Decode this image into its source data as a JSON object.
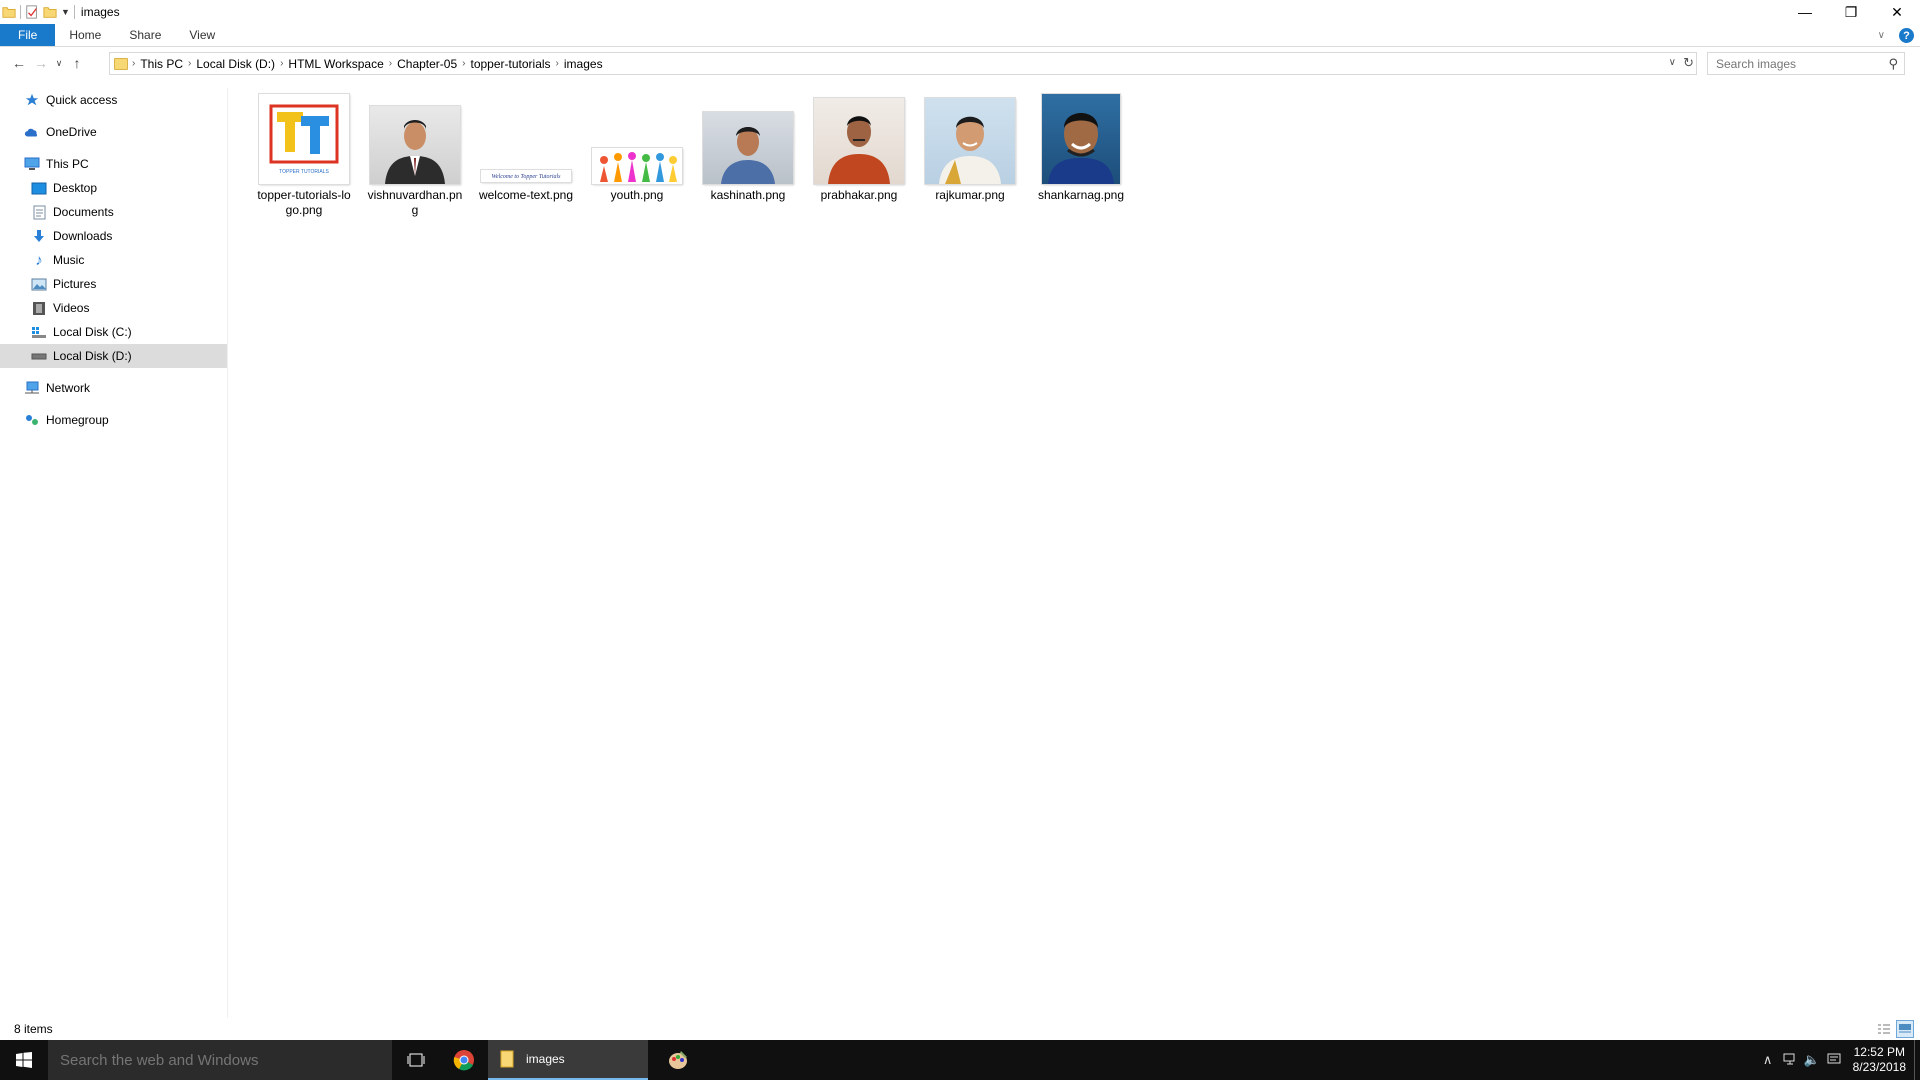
{
  "window": {
    "title": "images",
    "controls": {
      "minimize": "—",
      "restore": "❐",
      "close": "✕"
    }
  },
  "ribbon": {
    "tabs": [
      "File",
      "Home",
      "Share",
      "View"
    ],
    "help": "?"
  },
  "address": {
    "crumbs": [
      "This PC",
      "Local Disk (D:)",
      "HTML Workspace",
      "Chapter-05",
      "topper-tutorials",
      "images"
    ],
    "search_placeholder": "Search images"
  },
  "sidebar": {
    "quick_access": "Quick access",
    "onedrive": "OneDrive",
    "this_pc": "This PC",
    "pc_items": [
      "Desktop",
      "Documents",
      "Downloads",
      "Music",
      "Pictures",
      "Videos",
      "Local Disk (C:)",
      "Local Disk (D:)"
    ],
    "selected": "Local Disk (D:)",
    "network": "Network",
    "homegroup": "Homegroup"
  },
  "files": [
    {
      "name": "topper-tutorials-logo.png",
      "icon": "tt-logo-thumbnail"
    },
    {
      "name": "vishnuvardhan.png",
      "icon": "portrait-thumbnail"
    },
    {
      "name": "welcome-text.png",
      "icon": "text-banner-thumbnail"
    },
    {
      "name": "youth.png",
      "icon": "youth-graphic-thumbnail"
    },
    {
      "name": "kashinath.png",
      "icon": "portrait-thumbnail"
    },
    {
      "name": "prabhakar.png",
      "icon": "portrait-thumbnail"
    },
    {
      "name": "rajkumar.png",
      "icon": "portrait-thumbnail"
    },
    {
      "name": "shankarnag.png",
      "icon": "portrait-thumbnail"
    }
  ],
  "thumb_texts": {
    "logo_caption": "TOPPER TUTORIALS",
    "welcome_text": "Welcome to Topper Tutorials"
  },
  "status": {
    "item_count": "8 items"
  },
  "taskbar": {
    "search_placeholder": "Search the web and Windows",
    "active_app": "images",
    "time": "12:52 PM",
    "date": "8/23/2018"
  },
  "colors": {
    "accent": "#1979ca",
    "selection": "#dcdcdc",
    "taskbar": "#101010"
  }
}
